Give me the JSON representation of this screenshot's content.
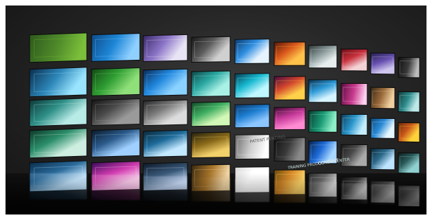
{
  "image": {
    "subject": "video-wall",
    "rows": 5,
    "columns": 10,
    "tile_text": {
      "r4c6": "PATENT PENDING",
      "r4c7": "TRAINING PRODUCTION CENTER",
      "r5c7": "CONTENT"
    }
  },
  "palette": [
    [
      "#2e5a1c",
      "#4f8a2a",
      "#7bbf3a"
    ],
    [
      "#0e4c8a",
      "#1d86d6",
      "#8fd0ff"
    ],
    [
      "#3a2a6a",
      "#8b74c7",
      "#e8e4f5"
    ],
    [
      "#1a1a1a",
      "#5a5a5a",
      "#d0d0d0"
    ],
    [
      "#0b3b70",
      "#2e8ee0",
      "#e6f3ff"
    ],
    [
      "#5a1a0a",
      "#d8561a",
      "#ffc24a"
    ],
    [
      "#303a3a",
      "#8a9a9a",
      "#e8eeee"
    ],
    [
      "#6a0c14",
      "#c8303c",
      "#f3d3d6"
    ],
    [
      "#27204f",
      "#6650b0",
      "#cfc6ee"
    ],
    [
      "#0f0f0f",
      "#3a3a3a",
      "#bdbdbd"
    ],
    [
      "#0a2f4f",
      "#2c86b8",
      "#9ae4ff"
    ],
    [
      "#114a14",
      "#2f9e33",
      "#90e07a"
    ],
    [
      "#0a2d5a",
      "#2086dc",
      "#8ad2ff"
    ],
    [
      "#0e4a4a",
      "#2aa7a1",
      "#a9f0e5"
    ],
    [
      "#053e53",
      "#17b9d0",
      "#bff7ff"
    ],
    [
      "#4a0a40",
      "#d3472d",
      "#ffd14a"
    ],
    [
      "#0b3454",
      "#2d9ad6",
      "#d6f4ff"
    ],
    [
      "#5a0b3f",
      "#c93b8e",
      "#ffd2f0"
    ],
    [
      "#3a2a1a",
      "#9a6a3a",
      "#f0d0a0"
    ],
    [
      "#143a3a",
      "#2c8a8a",
      "#bde8e8"
    ],
    [
      "#0d3a3a",
      "#2e8f87",
      "#b8eae6"
    ],
    [
      "#161616",
      "#4a4a4a",
      "#9a9a9a"
    ],
    [
      "#2a2a2a",
      "#7a7a7a",
      "#dcdcdc"
    ],
    [
      "#134d2b",
      "#3fae61",
      "#d2f7b6"
    ],
    [
      "#0c3b6a",
      "#1d7ed1",
      "#8cc6ff"
    ],
    [
      "#3a0a2e",
      "#c83c9c",
      "#ff8bd2"
    ],
    [
      "#0a3b32",
      "#1a9a75",
      "#8ff0c8"
    ],
    [
      "#0a3b56",
      "#2b96cc",
      "#c4eeff"
    ],
    [
      "#0a4a7a",
      "#2a8ad6",
      "#e6f6ff"
    ],
    [
      "#6a2a0a",
      "#c8551a",
      "#ffd23a"
    ],
    [
      "#0d3a2a",
      "#2b8e6a",
      "#cdeee0"
    ],
    [
      "#0a1a2a",
      "#2b5a8a",
      "#9fd0ff"
    ],
    [
      "#0a2a3a",
      "#1d6a9a",
      "#c3e8ff"
    ],
    [
      "#2a2410",
      "#8a6a1a",
      "#f2d06a"
    ],
    [
      "#6a6a6a",
      "#cfcfcf",
      "#ffffff"
    ],
    [
      "#101010",
      "#3a3a3a",
      "#8a8a8a"
    ],
    [
      "#05224a",
      "#1d6ad8",
      "#a8d8ff"
    ],
    [
      "#1a1a1a",
      "#4a4a4a",
      "#aaaaaa"
    ],
    [
      "#0b2a3a",
      "#2d6a8a",
      "#bde3ff"
    ],
    [
      "#0e1e1e",
      "#2a5a5a",
      "#90d0d0"
    ],
    [
      "#0a2f4f",
      "#2a6a9a",
      "#c8e8ff"
    ],
    [
      "#3a0a5a",
      "#d03cb0",
      "#ffd0f0"
    ],
    [
      "#0e1a2a",
      "#3a5a7a",
      "#cfe2ff"
    ],
    [
      "#3a2a10",
      "#a8752a",
      "#f2d6a6"
    ],
    [
      "#d7d7d7",
      "#ffffff",
      "#ffffff"
    ],
    [
      "#6a4a0a",
      "#d88a2a",
      "#ffd66a"
    ],
    [
      "#2c2c2c",
      "#6a6a6a",
      "#dadada"
    ],
    [
      "#0e0e0e",
      "#3a3a3a",
      "#cfcfcf"
    ],
    [
      "#1e1e1e",
      "#4b4b4b",
      "#b8b8b8"
    ],
    [
      "#1a1a1a",
      "#3a3a3a",
      "#9a9a9a"
    ]
  ]
}
